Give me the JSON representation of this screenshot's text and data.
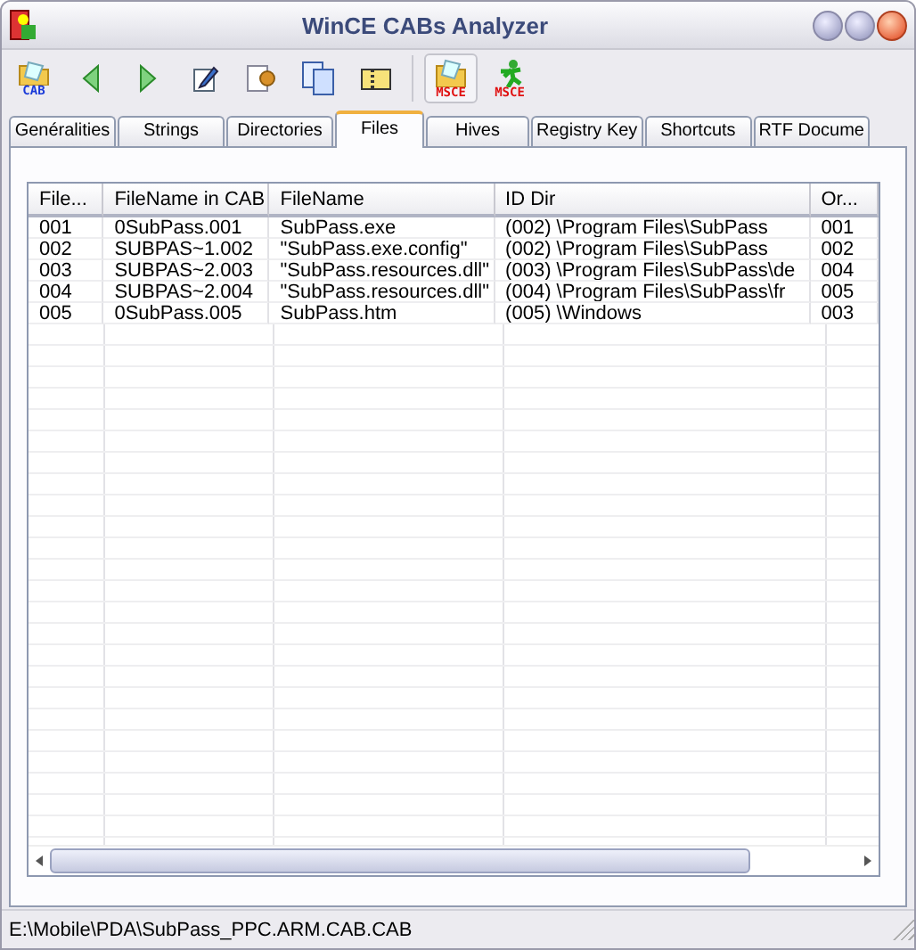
{
  "window": {
    "title": "WinCE CABs Analyzer"
  },
  "toolbar": [
    {
      "kind": "cab-folder",
      "label": "CAB",
      "pressed": false
    },
    {
      "kind": "arrow-left",
      "pressed": false
    },
    {
      "kind": "arrow-right",
      "pressed": false
    },
    {
      "kind": "notepad",
      "pressed": false
    },
    {
      "kind": "doc-gear",
      "pressed": false
    },
    {
      "kind": "copy",
      "pressed": false
    },
    {
      "kind": "zip",
      "pressed": false
    },
    {
      "kind": "msce-folder",
      "label": "MSCE",
      "pressed": true
    },
    {
      "kind": "msce-run",
      "label": "MSCE",
      "pressed": false
    }
  ],
  "tabs": [
    {
      "label": "Genéralities",
      "selected": false
    },
    {
      "label": "Strings",
      "selected": false
    },
    {
      "label": "Directories",
      "selected": false
    },
    {
      "label": "Files",
      "selected": true
    },
    {
      "label": "Hives",
      "selected": false
    },
    {
      "label": "Registry Key",
      "selected": false
    },
    {
      "label": "Shortcuts",
      "selected": false
    },
    {
      "label": "RTF Docume",
      "selected": false
    }
  ],
  "table": {
    "columns": [
      "File...",
      "FileName in CAB",
      "FileName",
      "ID Dir",
      "Or..."
    ],
    "rows": [
      [
        "001",
        "0SubPass.001",
        "SubPass.exe",
        "(002) \\Program Files\\SubPass",
        "001"
      ],
      [
        "002",
        "SUBPAS~1.002",
        "\"SubPass.exe.config\"",
        "(002) \\Program Files\\SubPass",
        "002"
      ],
      [
        "003",
        "SUBPAS~2.003",
        "\"SubPass.resources.dll\"",
        "(003) \\Program Files\\SubPass\\de",
        "004"
      ],
      [
        "004",
        "SUBPAS~2.004",
        "\"SubPass.resources.dll\"",
        "(004) \\Program Files\\SubPass\\fr",
        "005"
      ],
      [
        "005",
        "0SubPass.005",
        "SubPass.htm",
        "(005) \\Windows",
        "003"
      ]
    ]
  },
  "status_bar": "E:\\Mobile\\PDA\\SubPass_PPC.ARM.CAB.CAB"
}
